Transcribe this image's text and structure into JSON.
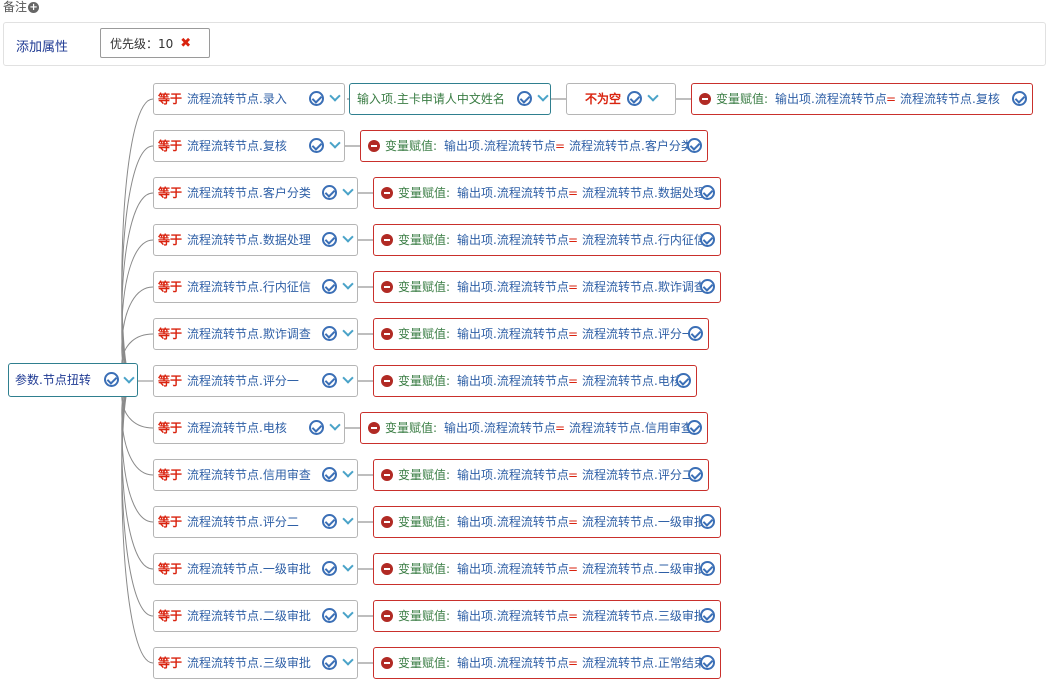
{
  "remark_label": "备注",
  "add_attribute_label": "添加属性",
  "priority_chip": {
    "text": "优先级：10"
  },
  "root_node": {
    "label": "参数.节点扭转"
  },
  "top_condition": {
    "input_label": "输入项.主卡申请人中文姓名",
    "op_label": "不为空"
  },
  "equals_keyword": "等于",
  "assign_label": "变量赋值:",
  "output_label": "输出项.流程流转节点",
  "equals_sign": "=",
  "rows": [
    {
      "value": "流程流转节点.录入",
      "target": "流程流转节点.复核"
    },
    {
      "value": "流程流转节点.复核",
      "target": "流程流转节点.客户分类"
    },
    {
      "value": "流程流转节点.客户分类",
      "target": "流程流转节点.数据处理"
    },
    {
      "value": "流程流转节点.数据处理",
      "target": "流程流转节点.行内征信"
    },
    {
      "value": "流程流转节点.行内征信",
      "target": "流程流转节点.欺诈调查"
    },
    {
      "value": "流程流转节点.欺诈调查",
      "target": "流程流转节点.评分一"
    },
    {
      "value": "流程流转节点.评分一",
      "target": "流程流转节点.电核"
    },
    {
      "value": "流程流转节点.电核",
      "target": "流程流转节点.信用审查"
    },
    {
      "value": "流程流转节点.信用审查",
      "target": "流程流转节点.评分二"
    },
    {
      "value": "流程流转节点.评分二",
      "target": "流程流转节点.一级审批"
    },
    {
      "value": "流程流转节点.一级审批",
      "target": "流程流转节点.二级审批"
    },
    {
      "value": "流程流转节点.二级审批",
      "target": "流程流转节点.三级审批"
    },
    {
      "value": "流程流转节点.三级审批",
      "target": "流程流转节点.正常结束"
    }
  ]
}
